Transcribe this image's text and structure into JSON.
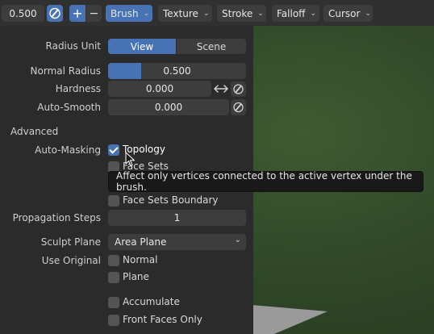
{
  "header": {
    "radius_value": "0.500",
    "add_symbol": "+",
    "subtract_symbol": "−",
    "menus": [
      "Brush",
      "Texture",
      "Stroke",
      "Falloff",
      "Cursor"
    ]
  },
  "panel": {
    "radius_unit": {
      "label": "Radius Unit",
      "options": [
        "View",
        "Scene"
      ],
      "selected": "View"
    },
    "normal_radius": {
      "label": "Normal Radius",
      "value": "0.500"
    },
    "hardness": {
      "label": "Hardness",
      "value": "0.000"
    },
    "auto_smooth": {
      "label": "Auto-Smooth",
      "value": "0.000"
    },
    "advanced_heading": "Advanced",
    "auto_masking": {
      "label": "Auto-Masking",
      "topology": "Topology",
      "face_sets_partial": "Face Sets",
      "face_sets_boundary": "Face Sets Boundary"
    },
    "propagation_steps": {
      "label": "Propagation Steps",
      "value": "1"
    },
    "sculpt_plane": {
      "label": "Sculpt Plane",
      "value": "Area Plane"
    },
    "use_original": {
      "label": "Use Original",
      "normal": "Normal",
      "plane": "Plane"
    },
    "accumulate": "Accumulate",
    "front_faces_only": "Front Faces Only"
  },
  "tooltip": {
    "text": "Affect only vertices connected to the active vertex under the brush."
  }
}
